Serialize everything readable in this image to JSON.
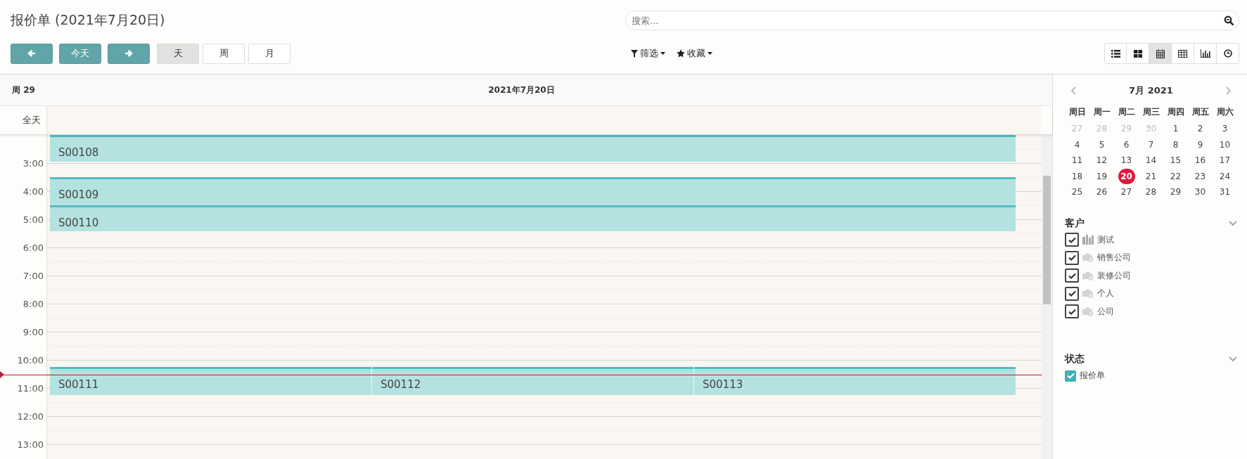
{
  "title": "报价单 (2021年7月20日)",
  "search": {
    "placeholder": "搜索..."
  },
  "nav_buttons": [
    {
      "kind": "prev"
    },
    {
      "kind": "today",
      "label": "今天"
    },
    {
      "kind": "next"
    }
  ],
  "scale_tabs": [
    {
      "label": "天",
      "selected": true
    },
    {
      "label": "周",
      "selected": false
    },
    {
      "label": "月",
      "selected": false
    }
  ],
  "filter_menus": [
    {
      "kind": "filter",
      "label": "筛选"
    },
    {
      "kind": "favorite",
      "label": "收藏"
    }
  ],
  "view_switcher": [
    {
      "kind": "list",
      "selected": false
    },
    {
      "kind": "kanban",
      "selected": false
    },
    {
      "kind": "calendar",
      "selected": true
    },
    {
      "kind": "pivot",
      "selected": false
    },
    {
      "kind": "graph",
      "selected": false
    },
    {
      "kind": "activity",
      "selected": false
    }
  ],
  "calendar": {
    "week_label": "周 29",
    "day_header": "2021年7月20日",
    "all_day_label": "全天",
    "hours": [
      "3:00",
      "4:00",
      "5:00",
      "6:00",
      "7:00",
      "8:00",
      "9:00",
      "10:00",
      "11:00",
      "12:00",
      "13:00"
    ],
    "events": [
      {
        "name": "S00108"
      },
      {
        "name": "S00109"
      },
      {
        "name": "S00110"
      },
      {
        "name": "S00111"
      },
      {
        "name": "S00112"
      },
      {
        "name": "S00113"
      }
    ]
  },
  "mini_calendar": {
    "title": "7月 2021",
    "weekdays": [
      "周日",
      "周一",
      "周二",
      "周三",
      "周四",
      "周五",
      "周六"
    ],
    "weeks": [
      [
        {
          "day": "27",
          "other_month": true,
          "selected": false
        },
        {
          "day": "28",
          "other_month": true,
          "selected": false
        },
        {
          "day": "29",
          "other_month": true,
          "selected": false
        },
        {
          "day": "30",
          "other_month": true,
          "selected": false
        },
        {
          "day": "1",
          "other_month": false,
          "selected": false
        },
        {
          "day": "2",
          "other_month": false,
          "selected": false
        },
        {
          "day": "3",
          "other_month": false,
          "selected": false
        }
      ],
      [
        {
          "day": "4",
          "other_month": false,
          "selected": false
        },
        {
          "day": "5",
          "other_month": false,
          "selected": false
        },
        {
          "day": "6",
          "other_month": false,
          "selected": false
        },
        {
          "day": "7",
          "other_month": false,
          "selected": false
        },
        {
          "day": "8",
          "other_month": false,
          "selected": false
        },
        {
          "day": "9",
          "other_month": false,
          "selected": false
        },
        {
          "day": "10",
          "other_month": false,
          "selected": false
        }
      ],
      [
        {
          "day": "11",
          "other_month": false,
          "selected": false
        },
        {
          "day": "12",
          "other_month": false,
          "selected": false
        },
        {
          "day": "13",
          "other_month": false,
          "selected": false
        },
        {
          "day": "14",
          "other_month": false,
          "selected": false
        },
        {
          "day": "15",
          "other_month": false,
          "selected": false
        },
        {
          "day": "16",
          "other_month": false,
          "selected": false
        },
        {
          "day": "17",
          "other_month": false,
          "selected": false
        }
      ],
      [
        {
          "day": "18",
          "other_month": false,
          "selected": false
        },
        {
          "day": "19",
          "other_month": false,
          "selected": false
        },
        {
          "day": "20",
          "other_month": false,
          "selected": true
        },
        {
          "day": "21",
          "other_month": false,
          "selected": false
        },
        {
          "day": "22",
          "other_month": false,
          "selected": false
        },
        {
          "day": "23",
          "other_month": false,
          "selected": false
        },
        {
          "day": "24",
          "other_month": false,
          "selected": false
        }
      ],
      [
        {
          "day": "25",
          "other_month": false,
          "selected": false
        },
        {
          "day": "26",
          "other_month": false,
          "selected": false
        },
        {
          "day": "27",
          "other_month": false,
          "selected": false
        },
        {
          "day": "28",
          "other_month": false,
          "selected": false
        },
        {
          "day": "29",
          "other_month": false,
          "selected": false
        },
        {
          "day": "30",
          "other_month": false,
          "selected": false
        },
        {
          "day": "31",
          "other_month": false,
          "selected": false
        }
      ]
    ]
  },
  "filter_sections": [
    {
      "title": "客户",
      "kind": "avatar",
      "items": [
        {
          "label": "测试",
          "checked": true,
          "kind": "photo"
        },
        {
          "label": "销售公司",
          "checked": true,
          "kind": "placeholder"
        },
        {
          "label": "装修公司",
          "checked": true,
          "kind": "placeholder"
        },
        {
          "label": "个人",
          "checked": true,
          "kind": "placeholder"
        },
        {
          "label": "公司",
          "checked": true,
          "kind": "placeholder"
        }
      ]
    },
    {
      "title": "状态",
      "kind": "color",
      "items": [
        {
          "label": "报价单",
          "checked": true
        }
      ]
    }
  ]
}
